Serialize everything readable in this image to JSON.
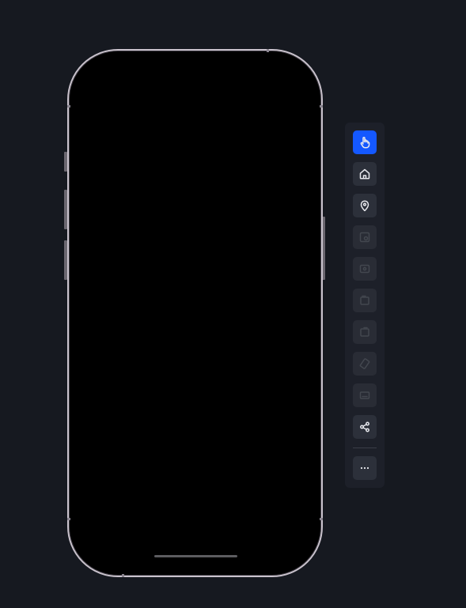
{
  "device": {
    "frame_color": "#c9c2cc",
    "screen_color": "#000000"
  },
  "toolbar": {
    "tools": [
      {
        "icon": "pointer-hand-icon",
        "state": "active"
      },
      {
        "icon": "home-icon",
        "state": "enabled"
      },
      {
        "icon": "location-pin-icon",
        "state": "enabled"
      },
      {
        "icon": "screenshot-icon",
        "state": "disabled"
      },
      {
        "icon": "screen-record-icon",
        "state": "disabled"
      },
      {
        "icon": "rotate-left-icon",
        "state": "disabled"
      },
      {
        "icon": "rotate-right-icon",
        "state": "disabled"
      },
      {
        "icon": "shake-icon",
        "state": "disabled"
      },
      {
        "icon": "keyboard-icon",
        "state": "disabled"
      },
      {
        "icon": "share-icon",
        "state": "enabled"
      }
    ],
    "more": {
      "icon": "more-dots-icon",
      "state": "enabled"
    }
  },
  "colors": {
    "background": "#161920",
    "toolbar_bg": "#1d2029",
    "button_bg": "#2c303a",
    "accent": "#1458ff"
  }
}
